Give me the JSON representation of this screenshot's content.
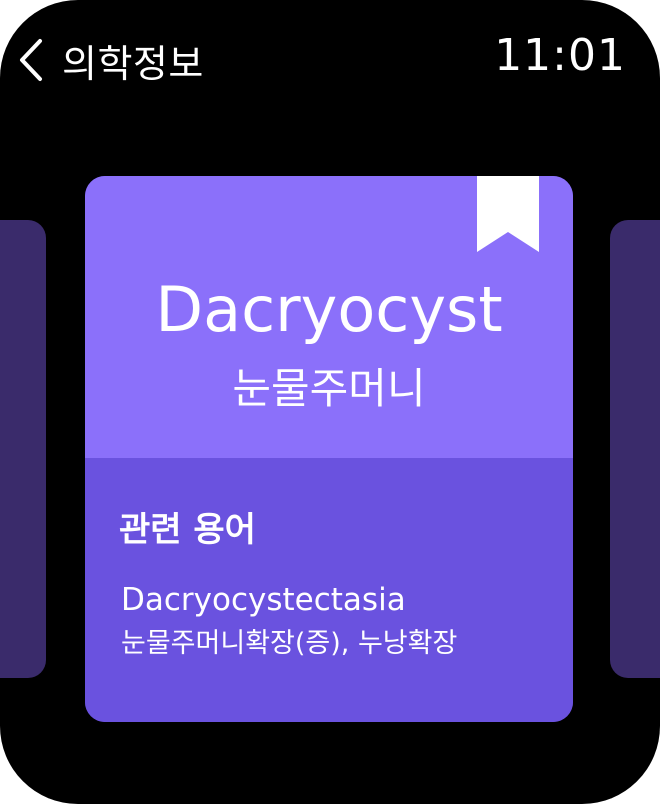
{
  "header": {
    "title": "의학정보",
    "time": "11:01",
    "back_icon": "chevron-left-icon"
  },
  "card": {
    "term_english": "Dacryocyst",
    "term_korean": "눈물주머니",
    "bookmark_icon": "bookmark-icon",
    "related": {
      "heading": "관련 용어",
      "term_english": "Dacryocystectasia",
      "term_korean": "눈물주머니확장(증), 누낭확장"
    }
  },
  "colors": {
    "background": "#000000",
    "card_top": "#8b70fa",
    "card_bottom": "#6a52df",
    "side_cards": "#3a2b6b",
    "text": "#ffffff"
  }
}
